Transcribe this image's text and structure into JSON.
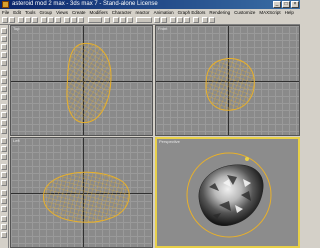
{
  "window": {
    "title": "asteroid mod 2 max - 3ds max 7 - Stand-alone License",
    "buttons": [
      "_",
      "□",
      "×"
    ]
  },
  "menu": [
    "File",
    "Edit",
    "Tools",
    "Group",
    "Views",
    "Create",
    "Modifiers",
    "Character",
    "reactor",
    "Animation",
    "Graph Editors",
    "Rendering",
    "Customize",
    "MAXScript",
    "Help"
  ],
  "viewports": {
    "top": {
      "label": "Top"
    },
    "front": {
      "label": "Front"
    },
    "left": {
      "label": "Left"
    },
    "perspective": {
      "label": "Perspective"
    }
  },
  "colors": {
    "viewport_bg": "#8a8a8a",
    "wire": "#e8b02a",
    "active_border": "#e8d048",
    "titlebar": "#0a246a"
  }
}
